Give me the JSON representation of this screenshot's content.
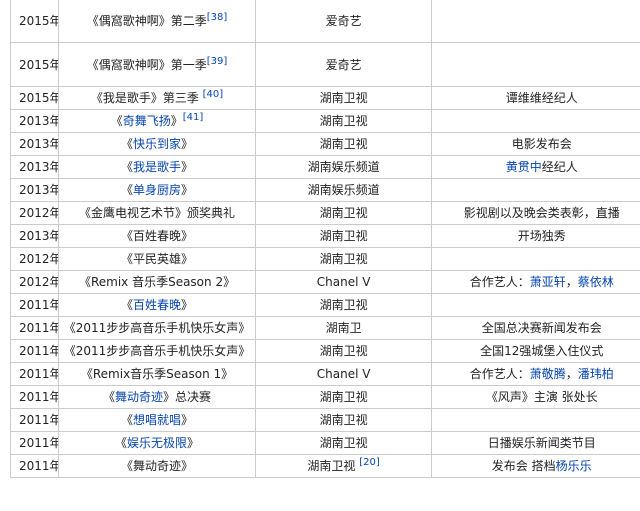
{
  "rows": [
    {
      "year": "2015年",
      "show": [
        {
          "t": "《偶窩歌神啊》第二季"
        },
        {
          "t": "[38]",
          "sup": true
        }
      ],
      "channel": [
        {
          "t": "爱奇艺"
        }
      ],
      "note": [],
      "tall": true
    },
    {
      "year": "2015年",
      "show": [
        {
          "t": "《偶窩歌神啊》第一季"
        },
        {
          "t": "[39]",
          "sup": true
        }
      ],
      "channel": [
        {
          "t": "爱奇艺"
        }
      ],
      "note": [],
      "tall": true
    },
    {
      "year": "2015年",
      "show": [
        {
          "t": "《我是歌手》第三季 "
        },
        {
          "t": "[40]",
          "sup": true
        }
      ],
      "channel": [
        {
          "t": "湖南卫视"
        }
      ],
      "note": [
        {
          "t": "谭维维经纪人"
        }
      ]
    },
    {
      "year": "2013年",
      "show": [
        {
          "t": "《"
        },
        {
          "t": "奇舞飞扬",
          "link": true
        },
        {
          "t": "》"
        },
        {
          "t": "[41]",
          "sup": true
        }
      ],
      "channel": [
        {
          "t": "湖南卫视"
        }
      ],
      "note": []
    },
    {
      "year": "2013年",
      "show": [
        {
          "t": "《"
        },
        {
          "t": "快乐到家",
          "link": true
        },
        {
          "t": "》"
        }
      ],
      "channel": [
        {
          "t": "湖南卫视"
        }
      ],
      "note": [
        {
          "t": "电影发布会"
        }
      ]
    },
    {
      "year": "2013年",
      "show": [
        {
          "t": "《"
        },
        {
          "t": "我是歌手",
          "link": true
        },
        {
          "t": "》"
        }
      ],
      "channel": [
        {
          "t": "湖南娱乐频道"
        }
      ],
      "note": [
        {
          "t": "黄贯中",
          "link": true
        },
        {
          "t": "经纪人"
        }
      ]
    },
    {
      "year": "2013年",
      "show": [
        {
          "t": "《"
        },
        {
          "t": "单身厨房",
          "link": true
        },
        {
          "t": "》"
        }
      ],
      "channel": [
        {
          "t": "湖南娱乐频道"
        }
      ],
      "note": []
    },
    {
      "year": "2012年",
      "show": [
        {
          "t": "《金鹰电视艺术节》颁奖典礼"
        }
      ],
      "channel": [
        {
          "t": "湖南卫视"
        }
      ],
      "note": [
        {
          "t": "影视剧以及晚会类表彰，直播"
        }
      ]
    },
    {
      "year": "2013年",
      "show": [
        {
          "t": "《百姓春晚》"
        }
      ],
      "channel": [
        {
          "t": "湖南卫视"
        }
      ],
      "note": [
        {
          "t": "开场独秀"
        }
      ]
    },
    {
      "year": "2012年",
      "show": [
        {
          "t": "《平民英雄》"
        }
      ],
      "channel": [
        {
          "t": "湖南卫视"
        }
      ],
      "note": []
    },
    {
      "year": "2012年",
      "show": [
        {
          "t": "《Remix 音乐季Season 2》"
        }
      ],
      "channel": [
        {
          "t": "Chanel V"
        }
      ],
      "note": [
        {
          "t": "合作艺人："
        },
        {
          "t": "萧亚轩",
          "link": true
        },
        {
          "t": "，"
        },
        {
          "t": "蔡依林",
          "link": true
        }
      ]
    },
    {
      "year": "2011年",
      "show": [
        {
          "t": "《"
        },
        {
          "t": "百姓春晚",
          "link": true
        },
        {
          "t": "》"
        }
      ],
      "channel": [
        {
          "t": "湖南卫视"
        }
      ],
      "note": []
    },
    {
      "year": "2011年",
      "show": [
        {
          "t": "《2011步步高音乐手机快乐女声》"
        }
      ],
      "channel": [
        {
          "t": "湖南卫"
        }
      ],
      "note": [
        {
          "t": "全国总决赛新闻发布会"
        }
      ]
    },
    {
      "year": "2011年",
      "show": [
        {
          "t": "《2011步步高音乐手机快乐女声》"
        }
      ],
      "channel": [
        {
          "t": "湖南卫视"
        }
      ],
      "note": [
        {
          "t": "全国12强城堡入住仪式"
        }
      ]
    },
    {
      "year": "2011年",
      "show": [
        {
          "t": "《Remix音乐季Season 1》"
        }
      ],
      "channel": [
        {
          "t": "Chanel V"
        }
      ],
      "note": [
        {
          "t": "合作艺人："
        },
        {
          "t": "萧敬腾",
          "link": true
        },
        {
          "t": "，"
        },
        {
          "t": "潘玮柏",
          "link": true
        }
      ]
    },
    {
      "year": "2011年",
      "show": [
        {
          "t": "《"
        },
        {
          "t": "舞动奇迹",
          "link": true
        },
        {
          "t": "》总决赛"
        }
      ],
      "channel": [
        {
          "t": "湖南卫视"
        }
      ],
      "note": [
        {
          "t": "《风声》主演 张处长"
        }
      ]
    },
    {
      "year": "2011年",
      "show": [
        {
          "t": "《"
        },
        {
          "t": "想唱就唱",
          "link": true
        },
        {
          "t": "》"
        }
      ],
      "channel": [
        {
          "t": "湖南卫视"
        }
      ],
      "note": []
    },
    {
      "year": "2011年",
      "show": [
        {
          "t": "《"
        },
        {
          "t": "娱乐无极限",
          "link": true
        },
        {
          "t": "》"
        }
      ],
      "channel": [
        {
          "t": "湖南卫视"
        }
      ],
      "note": [
        {
          "t": "日播娱乐新闻类节目"
        }
      ]
    },
    {
      "year": "2011年",
      "show": [
        {
          "t": "《舞动奇迹》"
        }
      ],
      "channel": [
        {
          "t": "湖南卫视 "
        },
        {
          "t": "[20]",
          "sup": true
        }
      ],
      "note": [
        {
          "t": "发布会 搭档"
        },
        {
          "t": "杨乐乐",
          "link": true
        }
      ]
    }
  ]
}
